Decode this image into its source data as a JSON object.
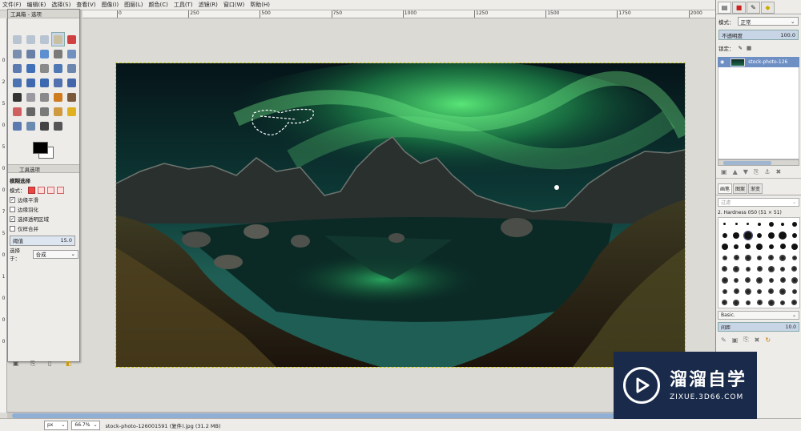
{
  "menu": [
    "文件(F)",
    "编辑(E)",
    "选择(S)",
    "查看(V)",
    "图像(I)",
    "图层(L)",
    "颜色(C)",
    "工具(T)",
    "滤镜(R)",
    "窗口(W)",
    "帮助(H)"
  ],
  "ruler_h": {
    "labels": [
      "0",
      "250",
      "500",
      "750",
      "1000",
      "1250",
      "1500",
      "1750",
      "2000"
    ]
  },
  "ruler_v": {
    "labels": [
      "0",
      "2",
      "5",
      "0",
      "5",
      "0",
      "0",
      "7",
      "5",
      "0",
      "1",
      "0",
      "0",
      "0"
    ]
  },
  "toolbox": {
    "title": "工具箱 - 选项",
    "options_title": "工具选项",
    "tool_name": "模糊选择",
    "mode_label": "模式：",
    "antialias": "边缘平滑",
    "feather": "边缘羽化",
    "select_transparent": "选择透明区域",
    "sample_merged": "仅样合并",
    "threshold_label": "阈值",
    "threshold_value": "15.0",
    "select_by_label": "选择于：",
    "select_by_value": "合成"
  },
  "dock": {
    "mode_label": "模式：",
    "mode_value": "正常",
    "opacity_label": "不透明度",
    "opacity_value": "100.0",
    "lock_label": "锁定：",
    "layer_name": "stock-photo-126",
    "brush_tabs": [
      "画笔",
      "图案",
      "渐变"
    ],
    "filter_placeholder": "过滤",
    "brush_name": "2. Hardness 050 (51 × 51)",
    "brush_preset": "Basic.",
    "spacing_label": "间距",
    "spacing_value": "10.0"
  },
  "status": {
    "unit": "px",
    "zoom": "66.7%",
    "file": "stock-photo-126001591 (复件).jpg (31.2 MB)"
  },
  "watermark": {
    "title": "溜溜自学",
    "url": "ZIXUE.3D66.COM"
  }
}
